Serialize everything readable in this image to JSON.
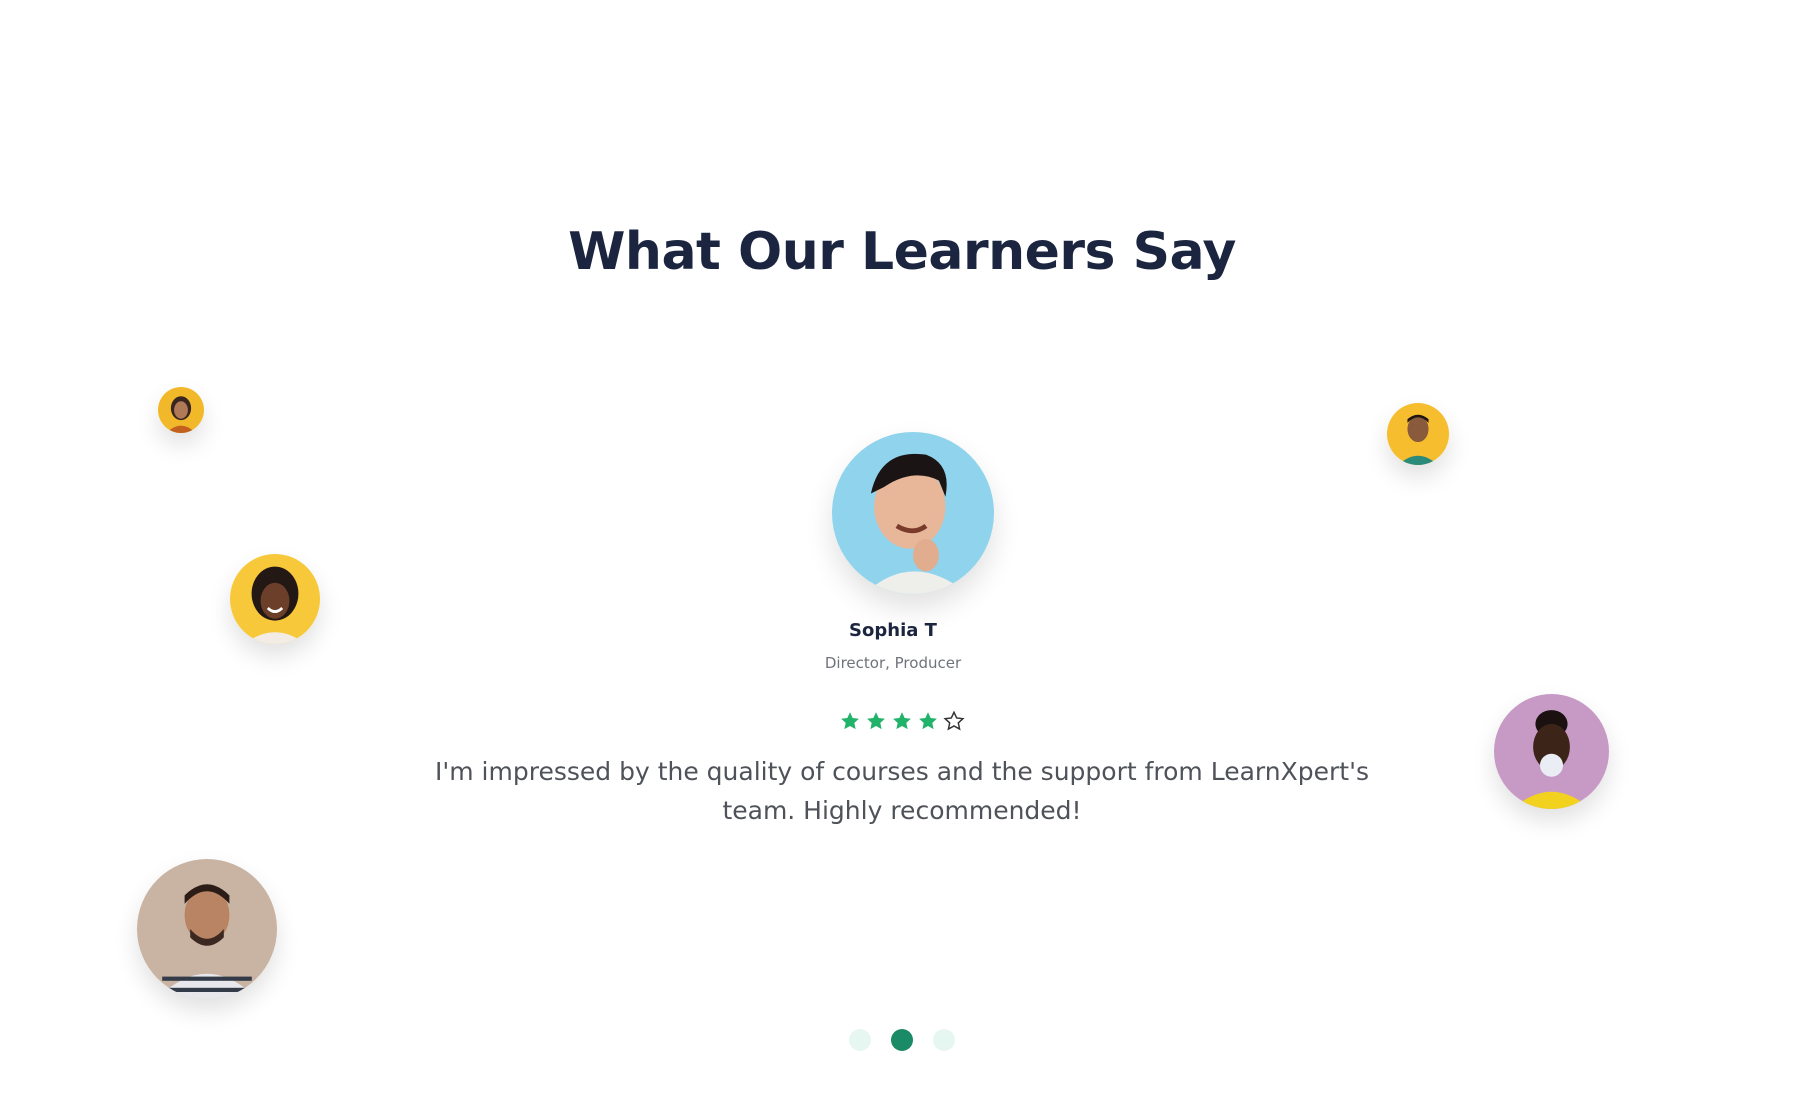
{
  "section": {
    "heading": "What Our Learners Say"
  },
  "testimonial": {
    "name": "Sophia T",
    "role": "Director, Producer",
    "rating": 4,
    "rating_max": 5,
    "quote": "I'm impressed by the quality of courses and the support from LearnXpert's team. Highly recommended!"
  },
  "carousel": {
    "total_slides": 3,
    "active_slide": 2
  },
  "colors": {
    "heading": "#1b2540",
    "star_filled": "#22b36a",
    "dot_active": "#1a8a67",
    "dot_inactive": "#e6f6f1"
  }
}
